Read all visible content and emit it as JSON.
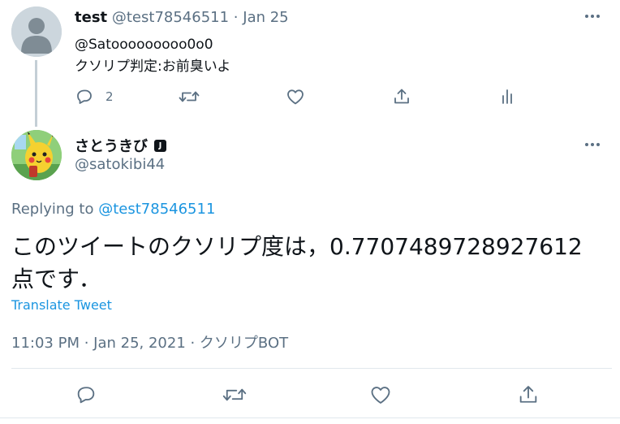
{
  "parent_tweet": {
    "display_name": "test",
    "handle": "@test78546511",
    "separator": "·",
    "date": "Jan 25",
    "text_line1": "@Satooooooooo0o0",
    "text_line2": "クソリプ判定:お前臭いよ",
    "reply_count": "2",
    "avatar_icon": "default-person-icon"
  },
  "main_tweet": {
    "display_name": "さとうきび",
    "badge": "J",
    "handle": "@satokibi44",
    "replying_prefix": "Replying to",
    "replying_handle": "@test78546511",
    "text_line1": "このツイートのクソリプ度は，0.7707489728927612",
    "text_line2": "点です．",
    "translate": "Translate Tweet",
    "meta": "11:03 PM · Jan 25, 2021 · クソリプBOT",
    "avatar_icon": "pikachu-avatar"
  },
  "colors": {
    "link": "#1b95e0",
    "muted": "#5b7083",
    "text": "#0f1419",
    "thread_line": "#c4cfd6"
  }
}
